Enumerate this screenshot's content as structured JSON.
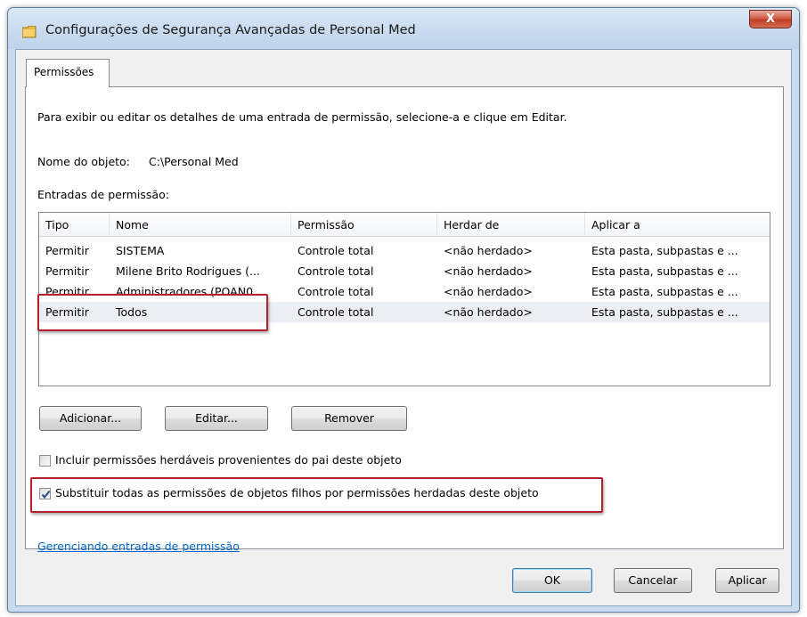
{
  "window": {
    "title": "Configurações de Segurança Avançadas de Personal Med",
    "close_label": "X"
  },
  "tab": {
    "label": "Permissões"
  },
  "instructions": "Para exibir ou editar os detalhes de uma entrada de permissão, selecione-a e clique em Editar.",
  "object_name": {
    "label": "Nome do objeto:",
    "value": "C:\\Personal Med"
  },
  "entries": {
    "label": "Entradas de permissão:",
    "columns": [
      "Tipo",
      "Nome",
      "Permissão",
      "Herdar de",
      "Aplicar a"
    ],
    "rows": [
      [
        "Permitir",
        "SISTEMA",
        "Controle total",
        "<não herdado>",
        "Esta pasta, subpastas e ..."
      ],
      [
        "Permitir",
        "Milene Brito Rodrigues (...",
        "Controle total",
        "<não herdado>",
        "Esta pasta, subpastas e ..."
      ],
      [
        "Permitir",
        "Administradores (POAN0...",
        "Controle total",
        "<não herdado>",
        "Esta pasta, subpastas e ..."
      ],
      [
        "Permitir",
        "Todos",
        "Controle total",
        "<não herdado>",
        "Esta pasta, subpastas e ..."
      ]
    ],
    "selected_row": 3
  },
  "buttons": {
    "add": "Adicionar...",
    "edit": "Editar...",
    "remove": "Remover",
    "ok": "OK",
    "cancel": "Cancelar",
    "apply": "Aplicar"
  },
  "checkboxes": {
    "include_inheritable": {
      "label": "Incluir permissões herdáveis provenientes do pai deste objeto",
      "checked": false
    },
    "replace_child": {
      "label": "Substituir todas as permissões de objetos filhos por permissões herdadas deste objeto",
      "checked": true
    }
  },
  "help_link": "Gerenciando entradas de permissão",
  "colors": {
    "highlight": "#b5202d",
    "link": "#0066cc",
    "selection": "#ebeef2"
  }
}
